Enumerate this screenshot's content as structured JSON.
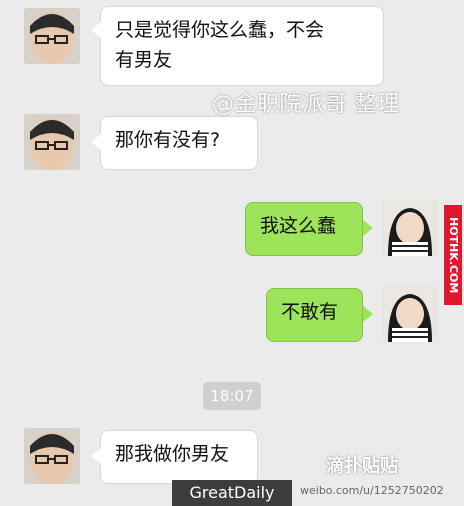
{
  "messages": [
    {
      "side": "left",
      "text1": "只是觉得你这么蠢，不会",
      "text2": "有男友"
    },
    {
      "side": "left",
      "text1": "那你有没有?"
    },
    {
      "side": "right",
      "text1": "我这么蠢"
    },
    {
      "side": "right",
      "text1": "不敢有"
    },
    {
      "side": "left",
      "text1": "那我做你男友"
    }
  ],
  "timestamp": "18:07",
  "watermark": "@金职院派哥 整理",
  "side_tag": "HOTHK.COM",
  "footer": {
    "brand": "GreatDaily",
    "weibo": "weibo.com/u/1252750202",
    "logo": "滴扑贴贴"
  },
  "colors": {
    "bg": "#ebebeb",
    "left_bubble": "#ffffff",
    "right_bubble": "#9de45a"
  }
}
